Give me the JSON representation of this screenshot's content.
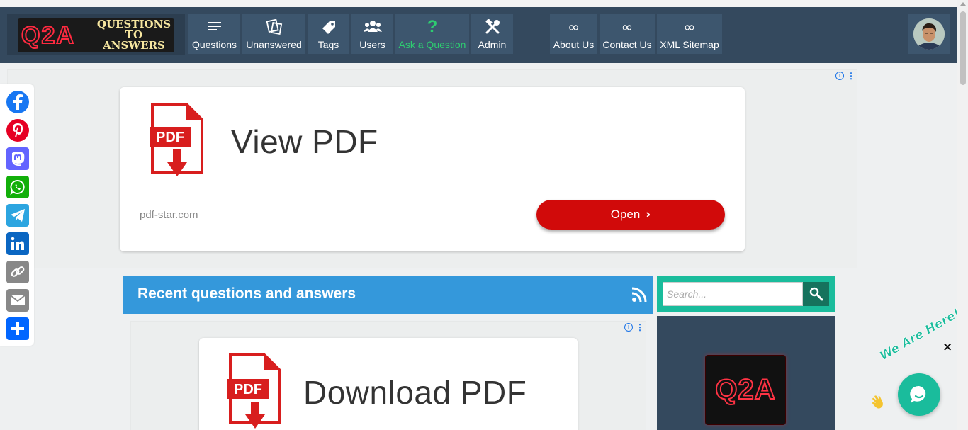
{
  "site": {
    "logo_short": "Q2A",
    "logo_tagline_lines": [
      "QUESTIONS",
      "TO",
      "ANSWERS"
    ]
  },
  "nav": {
    "items": [
      {
        "label": "Questions",
        "icon": "list-icon"
      },
      {
        "label": "Unanswered",
        "icon": "unanswered-icon"
      },
      {
        "label": "Tags",
        "icon": "tag-icon"
      },
      {
        "label": "Users",
        "icon": "users-icon"
      },
      {
        "label": "Ask a Question",
        "icon": "question-mark-icon",
        "color": "#2ecc71"
      },
      {
        "label": "Admin",
        "icon": "tools-icon"
      }
    ],
    "pages": [
      {
        "label": "About Us",
        "icon": "infinity-icon",
        "glyph": "∞"
      },
      {
        "label": "Contact Us",
        "icon": "infinity-icon",
        "glyph": "∞"
      },
      {
        "label": "XML Sitemap",
        "icon": "infinity-icon",
        "glyph": "∞"
      }
    ]
  },
  "ads": {
    "top": {
      "badge_icon": "info-icon",
      "badge_glyph": "i",
      "menu_glyph": "⋮",
      "title": "View PDF",
      "domain": "pdf-star.com",
      "button_label": "Open",
      "button_chevron": "›",
      "button_color": "#d10a0a",
      "pdf_icon_label": "PDF"
    },
    "inline": {
      "badge_glyph": "i",
      "menu_glyph": "⋮",
      "title": "Download PDF",
      "pdf_icon_label": "PDF"
    }
  },
  "share": {
    "buttons": [
      {
        "name": "facebook-icon",
        "color": "#1877f2"
      },
      {
        "name": "pinterest-icon",
        "color": "#e60023"
      },
      {
        "name": "mastodon-icon",
        "color": "#6364ff"
      },
      {
        "name": "whatsapp-icon",
        "color": "#12af0a"
      },
      {
        "name": "telegram-icon",
        "color": "#2ca5e0"
      },
      {
        "name": "linkedin-icon",
        "color": "#0a66c2"
      },
      {
        "name": "copy-link-icon",
        "color": "#888888"
      },
      {
        "name": "email-icon",
        "color": "#888888"
      },
      {
        "name": "share-plus-icon",
        "color": "#0166ff"
      }
    ]
  },
  "main": {
    "section_title": "Recent questions and answers",
    "section_color": "#3498db"
  },
  "sidebar": {
    "search_placeholder": "Search...",
    "search_accent": "#1abc9c",
    "logo_text": "Q2A"
  },
  "chat": {
    "badge_text": "We Are Here!",
    "close_glyph": "×",
    "accent": "#1abc9c"
  },
  "colors": {
    "header": "#34495e",
    "nav_item": "#3d566e"
  }
}
